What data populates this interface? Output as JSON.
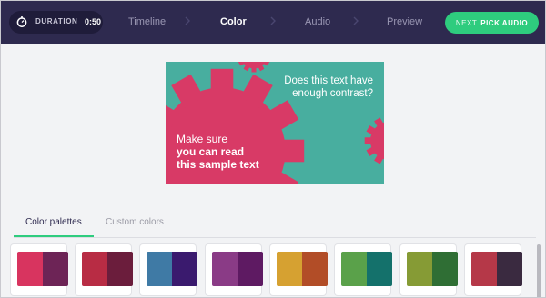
{
  "topbar": {
    "duration_label": "DURATION",
    "duration_value": "0:50",
    "duration_icon": "stopwatch-icon",
    "steps": [
      {
        "label": "Timeline",
        "active": false
      },
      {
        "label": "Color",
        "active": true
      },
      {
        "label": "Audio",
        "active": false
      },
      {
        "label": "Preview",
        "active": false
      }
    ],
    "next_button": {
      "prefix": "NEXT",
      "label": "PICK AUDIO"
    }
  },
  "preview": {
    "question": "Does this text have enough contrast?",
    "sample_line1": "Make sure",
    "sample_line2": "you can read",
    "sample_line3": "this sample text",
    "background_color": "#48ae9f",
    "accent_color": "#d83a66"
  },
  "tabs": [
    {
      "label": "Color palettes",
      "active": true
    },
    {
      "label": "Custom colors",
      "active": false
    }
  ],
  "palettes": [
    {
      "a": "#d8345f",
      "b": "#6d2456"
    },
    {
      "a": "#b82c44",
      "b": "#6b1d3c"
    },
    {
      "a": "#3f7aa5",
      "b": "#3a1a6e"
    },
    {
      "a": "#8a3b86",
      "b": "#5e1a62"
    },
    {
      "a": "#d6a131",
      "b": "#b24d27"
    },
    {
      "a": "#5aa14a",
      "b": "#14716b"
    },
    {
      "a": "#869b35",
      "b": "#2f6e34"
    },
    {
      "a": "#b53848",
      "b": "#3a2a40"
    }
  ],
  "colors": {
    "topbar_bg": "#2e2a4f",
    "accent_green": "#2ecc7e"
  }
}
